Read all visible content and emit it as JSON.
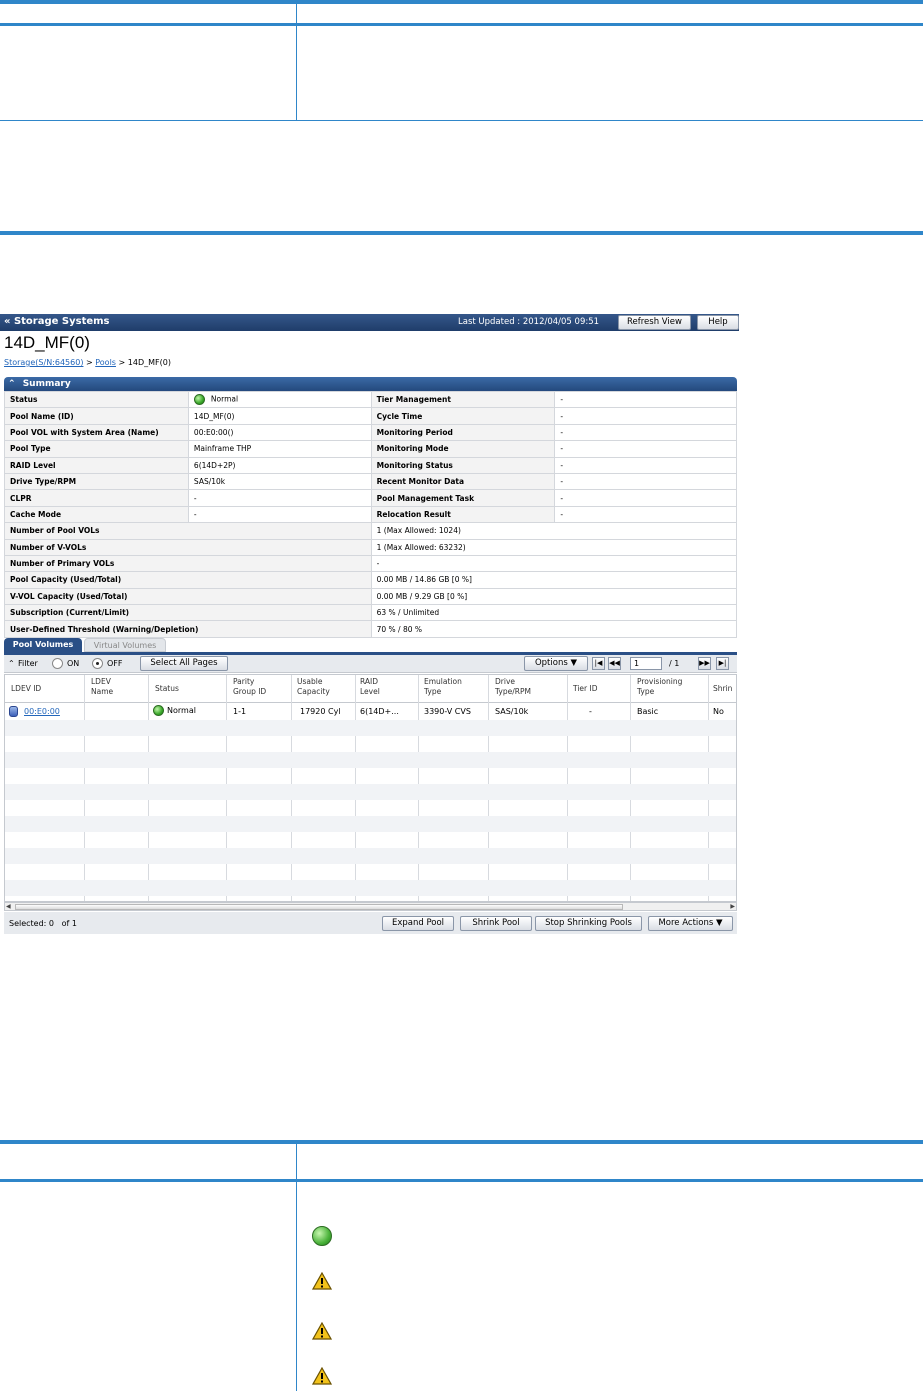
{
  "app": {
    "back_label": "« Storage Systems",
    "last_updated": "Last Updated : 2012/04/05 09:51",
    "refresh_label": "Refresh View",
    "help_label": "Help"
  },
  "page": {
    "title": "14D_MF(0)",
    "breadcrumb": {
      "storage": "Storage(S/N:64560)",
      "sep": ">",
      "pools": "Pools",
      "current": "> 14D_MF(0)"
    }
  },
  "summary": {
    "header": "Summary",
    "left_rows": [
      {
        "k": "Status",
        "v": "Normal"
      },
      {
        "k": "Pool Name (ID)",
        "v": "14D_MF(0)"
      },
      {
        "k": "Pool VOL with System Area (Name)",
        "v": "00:E0:00()"
      },
      {
        "k": "Pool Type",
        "v": "Mainframe THP"
      },
      {
        "k": "RAID Level",
        "v": "6(14D+2P)"
      },
      {
        "k": "Drive Type/RPM",
        "v": "SAS/10k"
      },
      {
        "k": "CLPR",
        "v": "-"
      },
      {
        "k": "Cache Mode",
        "v": "-"
      }
    ],
    "right_rows": [
      {
        "k": "Tier Management",
        "v": "-"
      },
      {
        "k": "Cycle Time",
        "v": "-"
      },
      {
        "k": "Monitoring Period",
        "v": "-"
      },
      {
        "k": "Monitoring Mode",
        "v": "-"
      },
      {
        "k": "Monitoring Status",
        "v": "-"
      },
      {
        "k": "Recent Monitor Data",
        "v": "-"
      },
      {
        "k": "Pool Management Task",
        "v": "-"
      },
      {
        "k": "Relocation Result",
        "v": "-"
      }
    ],
    "wide_rows": [
      {
        "k": "Number of Pool VOLs",
        "v": "1 (Max Allowed: 1024)"
      },
      {
        "k": "Number of V-VOLs",
        "v": "1 (Max Allowed: 63232)"
      },
      {
        "k": "Number of Primary VOLs",
        "v": "-"
      },
      {
        "k": "Pool Capacity (Used/Total)",
        "v": "0.00 MB / 14.86 GB [0 %]"
      },
      {
        "k": "V-VOL Capacity (Used/Total)",
        "v": "0.00 MB / 9.29 GB [0 %]"
      },
      {
        "k": "Subscription (Current/Limit)",
        "v": "63 % / Unlimited"
      },
      {
        "k": "User-Defined Threshold (Warning/Depletion)",
        "v": "70 % / 80 %"
      }
    ]
  },
  "tabs": {
    "pool_volumes": "Pool Volumes",
    "virtual_volumes": "Virtual Volumes"
  },
  "toolbar": {
    "filter": "Filter",
    "on": "ON",
    "off": "OFF",
    "select_all": "Select All Pages",
    "options": "Options ▼",
    "page": "1",
    "of_pages": "/ 1"
  },
  "grid": {
    "headers": [
      "LDEV ID",
      "LDEV\nName",
      "Status",
      "Parity\nGroup ID",
      "Usable\nCapacity",
      "RAID\nLevel",
      "Emulation\nType",
      "Drive\nType/RPM",
      "Tier ID",
      "Provisioning\nType",
      "Shrin"
    ],
    "row": {
      "ldev_id": "00:E0:00",
      "ldev_name": "",
      "status": "Normal",
      "parity_group": "1-1",
      "usable_capacity": "17920 Cyl",
      "raid_level": "6(14D+...",
      "emulation": "3390-V CVS",
      "drive": "SAS/10k",
      "tier_id": "-",
      "provisioning": "Basic",
      "shrink": "No"
    }
  },
  "footer": {
    "selected": "Selected: 0   of 1",
    "expand": "Expand Pool",
    "shrink": "Shrink Pool",
    "stop": "Stop Shrinking Pools",
    "more": "More Actions ▼"
  },
  "colors": {
    "accent": "#2f86c9",
    "title_bar": "#24497d",
    "status_normal": "#3aa82a",
    "warning": "#f2c21b"
  }
}
